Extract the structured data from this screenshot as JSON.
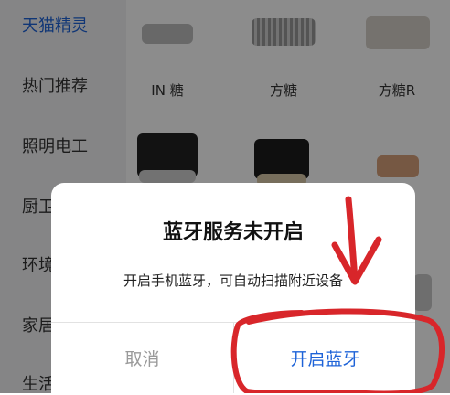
{
  "sidebar": {
    "items": [
      {
        "label": "天猫精灵",
        "active": true
      },
      {
        "label": "热门推荐"
      },
      {
        "label": "照明电工"
      },
      {
        "label": "厨卫"
      },
      {
        "label": "环境"
      },
      {
        "label": "家居"
      },
      {
        "label": "生活"
      }
    ]
  },
  "products": {
    "row1": [
      "IN 糖",
      "方糖",
      "方糖R"
    ],
    "partial_label": "灵"
  },
  "dialog": {
    "title": "蓝牙服务未开启",
    "message": "开启手机蓝牙，可自动扫描附近设备",
    "cancel_label": "取消",
    "confirm_label": "开启蓝牙"
  },
  "colors": {
    "accent": "#1e63d8",
    "annotation": "#d8262a"
  }
}
